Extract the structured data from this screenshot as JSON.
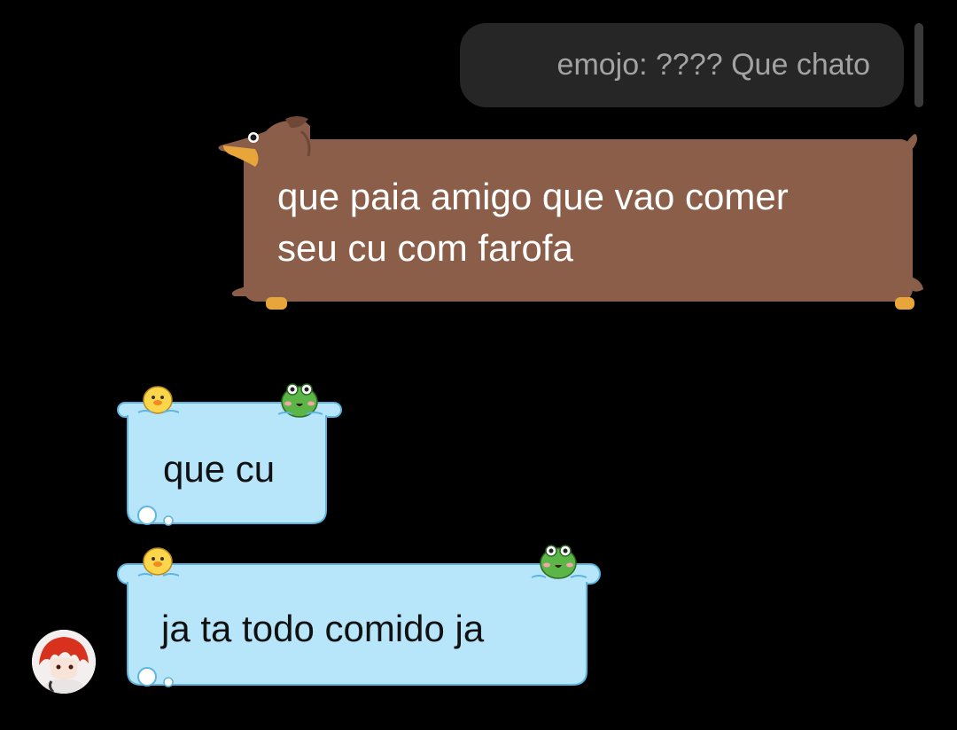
{
  "reply_preview": {
    "text": "emojo: ???? Que chato"
  },
  "messages": [
    {
      "id": "sent-1",
      "direction": "outgoing",
      "theme": "dachshund",
      "lines": [
        "que paia amigo que vao comer",
        "seu cu com farofa"
      ]
    },
    {
      "id": "recv-1",
      "direction": "incoming",
      "theme": "bathtub-duck-frog",
      "text": "que cu"
    },
    {
      "id": "recv-2",
      "direction": "incoming",
      "theme": "bathtub-duck-frog",
      "text": "ja ta todo comido ja"
    }
  ],
  "colors": {
    "background": "#000000",
    "reply_preview_bg": "#262626",
    "reply_preview_text": "#a3a3a3",
    "dog_bubble": "#8b5e49",
    "bath_bubble": "#b7e6fb",
    "bath_bubble_border": "#5fb5de"
  },
  "icons": {
    "sender_avatar": "red-haired-anime-avatar"
  }
}
